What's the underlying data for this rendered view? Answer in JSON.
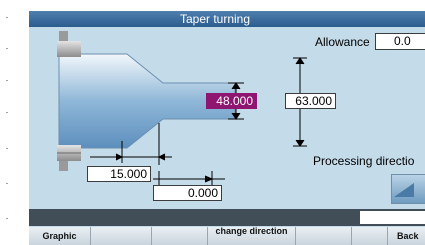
{
  "window": {
    "title": "Taper turning"
  },
  "fields": {
    "allowance_label": "Allowance",
    "allowance_value": "0.0",
    "diameter_small": "48.000",
    "diameter_large": "63.000",
    "length_taper": "15.000",
    "length_offset": "0.000",
    "processing_direction_label": "Processing directio"
  },
  "softkeys": {
    "graphic": "Graphic",
    "change_direction": "change direction",
    "back": "Back"
  },
  "colors": {
    "active_field": "#8e1670",
    "screen_background": "#c4dbe9",
    "titlebar": "#2b5c8e"
  }
}
